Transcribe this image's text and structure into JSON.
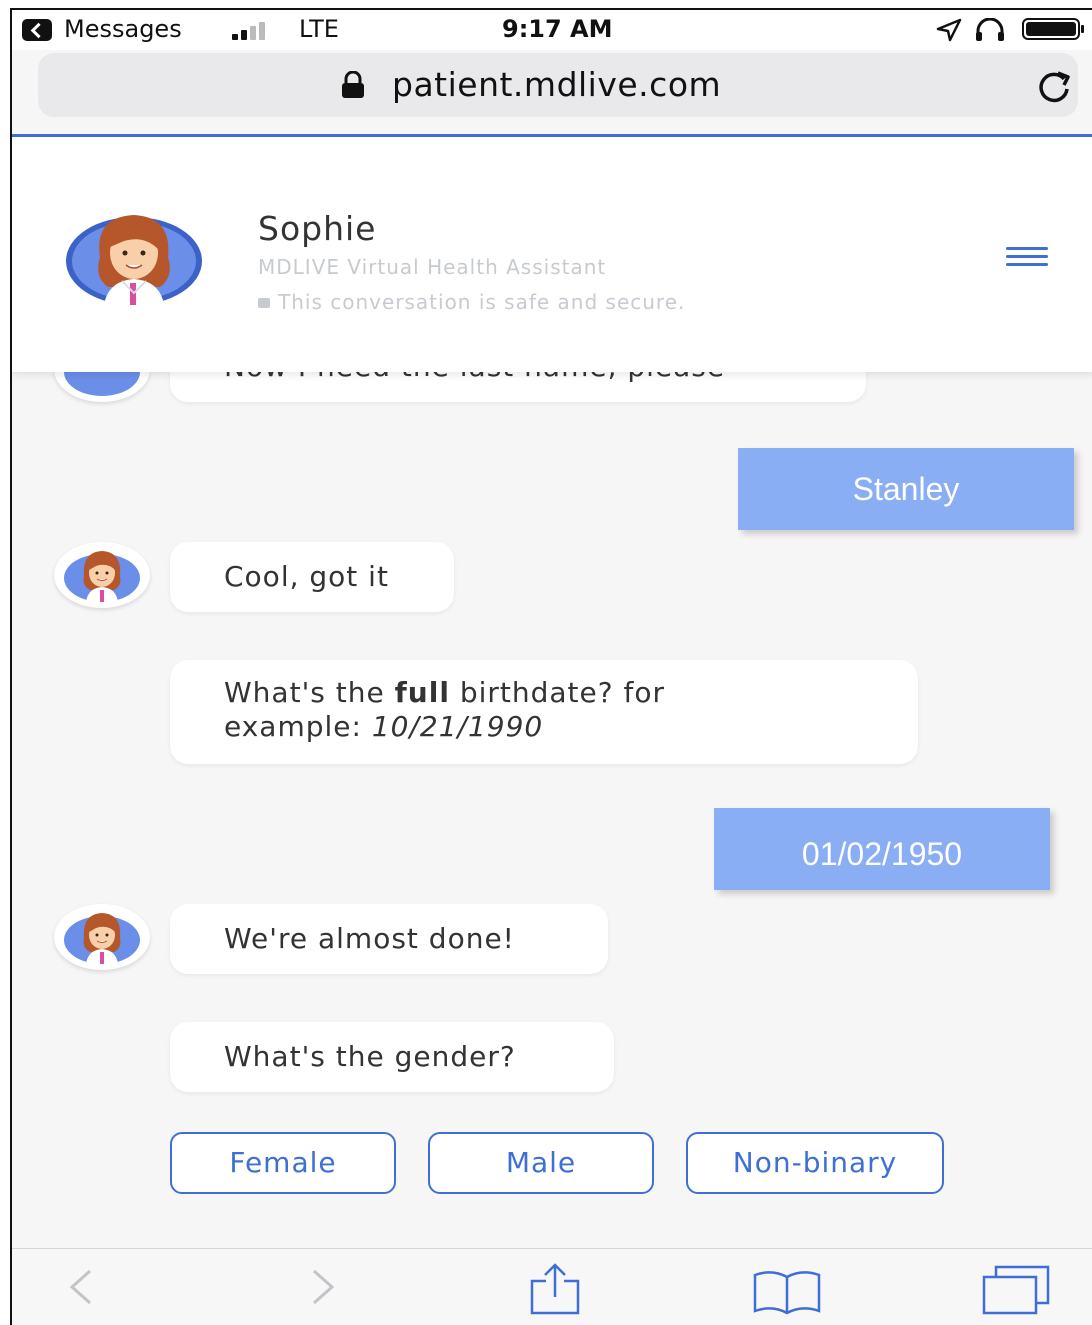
{
  "status_bar": {
    "back_app": "Messages",
    "network": "LTE",
    "time": "9:17 AM"
  },
  "browser": {
    "url": "patient.mdlive.com"
  },
  "header": {
    "name": "Sophie",
    "subtitle": "MDLIVE Virtual Health Assistant",
    "secure_note": "This conversation is safe and secure."
  },
  "messages": [
    {
      "from": "bot",
      "text": "Now I need the last name, please"
    },
    {
      "from": "user",
      "text": "Stanley"
    },
    {
      "from": "bot",
      "text": "Cool, got it"
    },
    {
      "from": "bot",
      "text_pre": "What's the ",
      "text_bold": "full",
      "text_post": " birthdate? for",
      "line2_pre": "example: ",
      "line2_italic": "10/21/1990"
    },
    {
      "from": "user",
      "text": "01/02/1950"
    },
    {
      "from": "bot",
      "text": "We're almost done!"
    },
    {
      "from": "bot",
      "text": "What's the gender?"
    }
  ],
  "options": [
    "Female",
    "Male",
    "Non-binary"
  ],
  "colors": {
    "accent": "#3f6fd4",
    "user_bubble": "#8aaef4",
    "background": "#f6f6f6"
  },
  "icons": [
    "back-icon",
    "lock-icon",
    "reload-icon",
    "location-icon",
    "headphones-icon",
    "battery-icon",
    "menu-icon",
    "back-arrow-icon",
    "forward-arrow-icon",
    "share-icon",
    "bookmarks-icon",
    "tabs-icon"
  ]
}
